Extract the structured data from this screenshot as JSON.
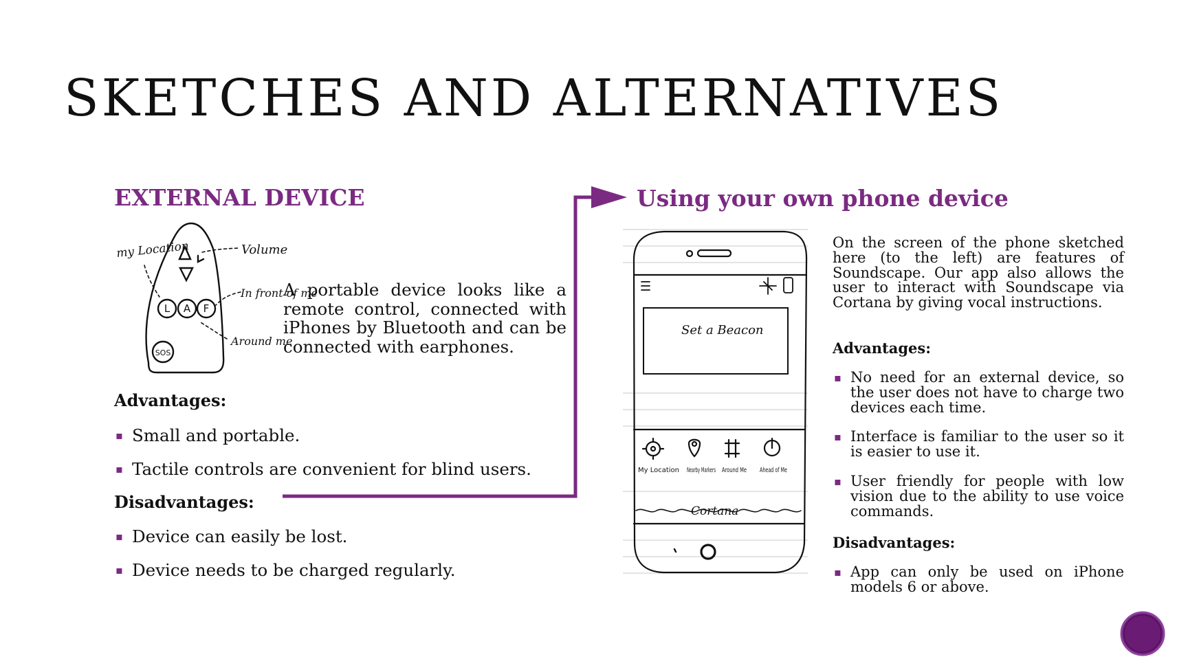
{
  "slide": {
    "title": "SKETCHES AND ALTERNATIVES",
    "accent_color": "#7b2a82"
  },
  "left": {
    "heading": "EXTERNAL DEVICE",
    "description": "A portable device looks like a remote control, connected with iPhones by Bluetooth and can be connected with earphones.",
    "sketch": {
      "labels": {
        "my_location": "my Location",
        "volume": "Volume",
        "in_front": "In front of me",
        "around_me": "Around me",
        "l": "L",
        "a": "A",
        "f": "F",
        "sos": "SOS"
      }
    },
    "advantages_title": "Advantages:",
    "advantages": [
      "Small and portable.",
      "Tactile controls are convenient for blind users."
    ],
    "disadvantages_title": "Disadvantages:",
    "disadvantages": [
      "Device can easily be lost.",
      "Device needs to be charged regularly."
    ]
  },
  "right": {
    "heading": "Using your own phone device",
    "description": "On the screen of the phone sketched here (to the left) are features of Soundscape. Our app also allows the user to interact with Soundscape via Cortana by giving vocal instructions.",
    "sketch": {
      "beacon_label": "Set a Beacon",
      "tabs": [
        "My Location",
        "Nearby Markers",
        "Around Me",
        "Ahead of Me"
      ],
      "cortana_label": "Cortana"
    },
    "advantages_title": "Advantages:",
    "advantages": [
      "No need for an external device, so the user does not have to charge two devices each time.",
      "Interface is familiar to the user so it is easier to use it.",
      "User friendly for people with low vision due to the ability to use voice commands."
    ],
    "disadvantages_title": "Disadvantages:",
    "disadvantages": [
      "App can only be used on iPhone models 6 or above."
    ]
  }
}
